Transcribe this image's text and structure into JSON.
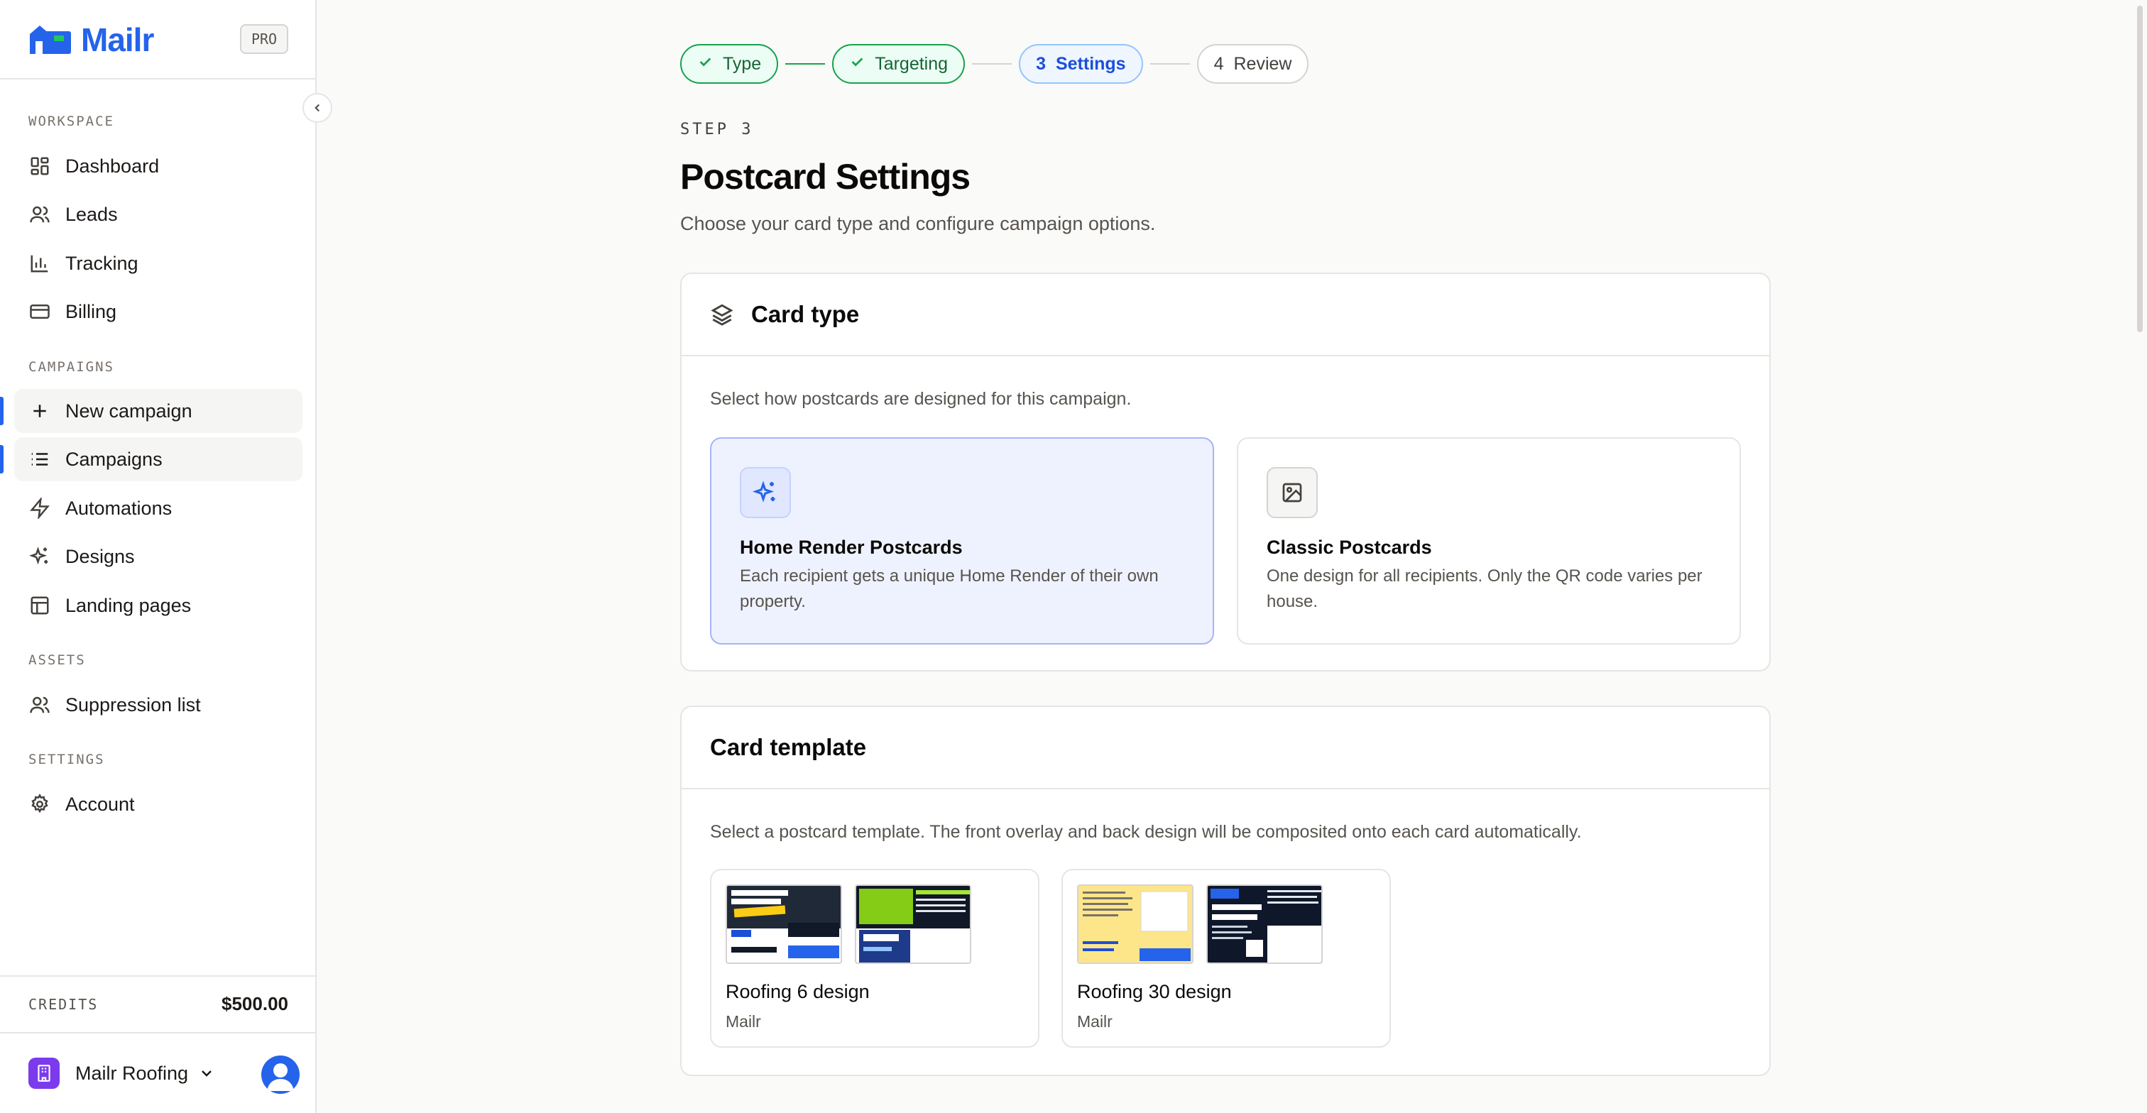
{
  "brand": {
    "name": "Mailr",
    "badge": "PRO"
  },
  "sidebar": {
    "sections": {
      "workspace": "WORKSPACE",
      "campaigns": "CAMPAIGNS",
      "assets": "ASSETS",
      "settings": "SETTINGS"
    },
    "items": {
      "dashboard": "Dashboard",
      "leads": "Leads",
      "tracking": "Tracking",
      "billing": "Billing",
      "new_campaign": "New campaign",
      "campaigns": "Campaigns",
      "automations": "Automations",
      "designs": "Designs",
      "landing_pages": "Landing pages",
      "suppression_list": "Suppression list",
      "account": "Account"
    },
    "credits_label": "CREDITS",
    "credits_value": "$500.00",
    "org_name": "Mailr Roofing"
  },
  "stepper": {
    "steps": [
      {
        "label": "Type",
        "status": "done"
      },
      {
        "label": "Targeting",
        "status": "done"
      },
      {
        "number": "3",
        "label": "Settings",
        "status": "current"
      },
      {
        "number": "4",
        "label": "Review",
        "status": "todo"
      }
    ]
  },
  "page": {
    "eyebrow": "STEP 3",
    "title": "Postcard Settings",
    "subtitle": "Choose your card type and configure campaign options."
  },
  "card_type": {
    "title": "Card type",
    "description": "Select how postcards are designed for this campaign.",
    "options": [
      {
        "title": "Home Render Postcards",
        "description": "Each recipient gets a unique Home Render of their own property.",
        "icon": "sparkles-icon",
        "selected": true
      },
      {
        "title": "Classic Postcards",
        "description": "One design for all recipients. Only the QR code varies per house.",
        "icon": "image-icon",
        "selected": false
      }
    ]
  },
  "card_template": {
    "title": "Card template",
    "description": "Select a postcard template. The front overlay and back design will be composited onto each card automatically.",
    "templates": [
      {
        "name": "Roofing 6 design",
        "brand": "Mailr"
      },
      {
        "name": "Roofing 30 design",
        "brand": "Mailr"
      }
    ]
  },
  "colors": {
    "accent": "#2563eb",
    "success": "#16a34a",
    "selected_bg": "#eef2ff"
  }
}
